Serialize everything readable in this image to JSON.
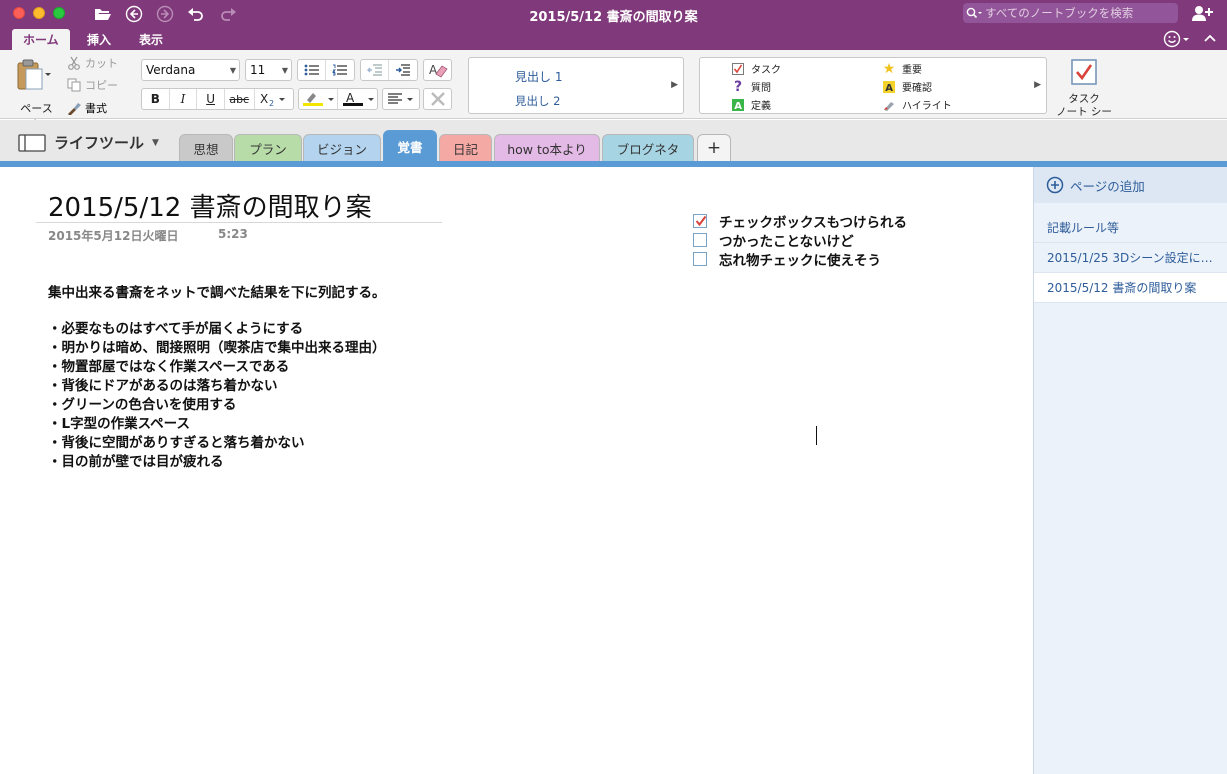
{
  "window": {
    "title": "2015/5/12 書斎の間取り案",
    "search_placeholder": "すべてのノートブックを検索"
  },
  "ribbon_tabs": [
    {
      "label": "ホーム",
      "active": true
    },
    {
      "label": "挿入",
      "active": false
    },
    {
      "label": "表示",
      "active": false
    }
  ],
  "ribbon": {
    "paste_label": "ペースト",
    "cut_label": "カット",
    "copy_label": "コピー",
    "format_label": "書式",
    "font_name": "Verdana",
    "font_size": "11",
    "styles": {
      "heading1": "見出し 1",
      "heading2": "見出し 2"
    },
    "tags": {
      "task": "タスク",
      "question": "質問",
      "definition": "定義",
      "important": "重要",
      "review": "要確認",
      "highlight": "ハイライト"
    },
    "todo_tag_line1": "タスク",
    "todo_tag_line2": "ノート シール"
  },
  "notebook": {
    "name": "ライフツール",
    "sections": [
      {
        "label": "思想",
        "color": "#c9c9c9",
        "active": false
      },
      {
        "label": "プラン",
        "color": "#b7dca8",
        "active": false
      },
      {
        "label": "ビジョン",
        "color": "#b3d3ee",
        "active": false
      },
      {
        "label": "覚書",
        "color": "#5b9bd5",
        "active": true
      },
      {
        "label": "日記",
        "color": "#f4a9a5",
        "active": false
      },
      {
        "label": "how to本より",
        "color": "#e3b9e6",
        "active": false
      },
      {
        "label": "ブログネタ",
        "color": "#a6d4e3",
        "active": false
      },
      {
        "label": "+",
        "color": "#f4f4f4",
        "active": false
      }
    ]
  },
  "page": {
    "title": "2015/5/12 書斎の間取り案",
    "date": "2015年5月12日火曜日",
    "time": "5:23",
    "intro": "集中出来る書斎をネットで調べた結果を下に列記する。",
    "bullets": [
      "・必要なものはすべて手が届くようにする",
      "・明かりは暗め、間接照明（喫茶店で集中出来る理由）",
      "・物置部屋ではなく作業スペースである",
      "・背後にドアがあるのは落ち着かない",
      "・グリーンの色合いを使用する",
      "・L字型の作業スペース",
      "・背後に空間がありすぎると落ち着かない",
      "・目の前が壁では目が疲れる"
    ],
    "checklist": [
      {
        "text": "チェックボックスもつけられる",
        "checked": true
      },
      {
        "text": "つかったことないけど",
        "checked": false
      },
      {
        "text": "忘れ物チェックに使えそう",
        "checked": false
      }
    ]
  },
  "pages_panel": {
    "add_page_label": "ページの追加",
    "pages": [
      {
        "title": "記載ルール等",
        "selected": false
      },
      {
        "title": "2015/1/25 3Dシーン設定に…",
        "selected": false
      },
      {
        "title": "2015/5/12 書斎の間取り案",
        "selected": true
      }
    ]
  },
  "colors": {
    "titlebar": "#80397b",
    "section_strip": "#5b9bd5",
    "link_blue": "#2e5d9a"
  }
}
